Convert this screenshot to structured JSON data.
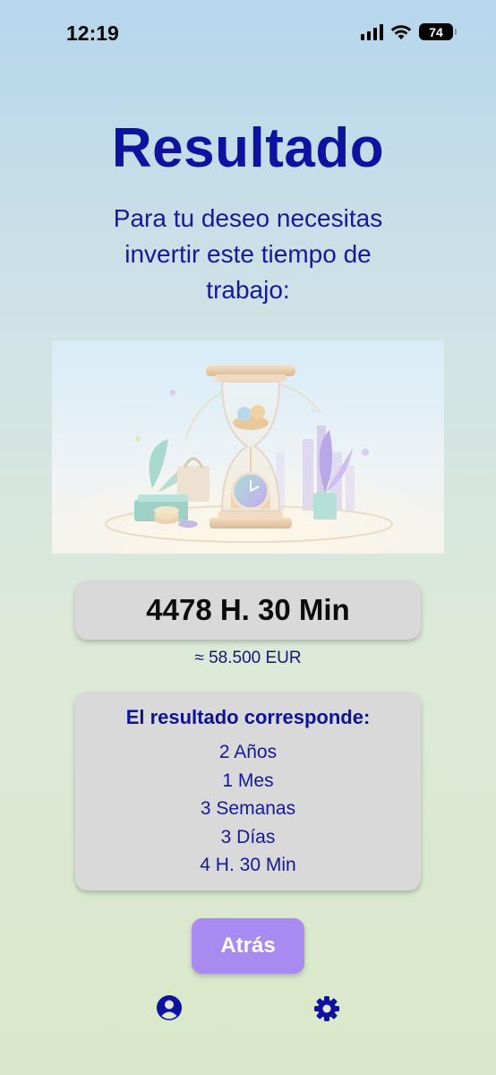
{
  "status_bar": {
    "time": "12:19",
    "battery": "74",
    "icons": [
      "signal-icon",
      "wifi-icon",
      "battery-icon"
    ]
  },
  "title": "Resultado",
  "subtitle": "Para tu deseo necesitas invertir este tiempo de trabajo:",
  "illustration": {
    "icon": "hourglass-coins-icon"
  },
  "hours_result": "4478 H. 30 Min",
  "amount": "≈ 58.500 EUR",
  "breakdown": {
    "heading": "El resultado corresponde:",
    "items": [
      "2 Años",
      "1 Mes",
      "3 Semanas",
      "3 Días",
      "4 H. 30 Min"
    ]
  },
  "back_label": "Atrás",
  "tab_bar": {
    "items": [
      "profile-icon",
      "settings-icon"
    ]
  },
  "colors": {
    "accent": "#a78bf0",
    "text_primary": "#0d12a0",
    "card_bg": "#d9d9d9"
  }
}
